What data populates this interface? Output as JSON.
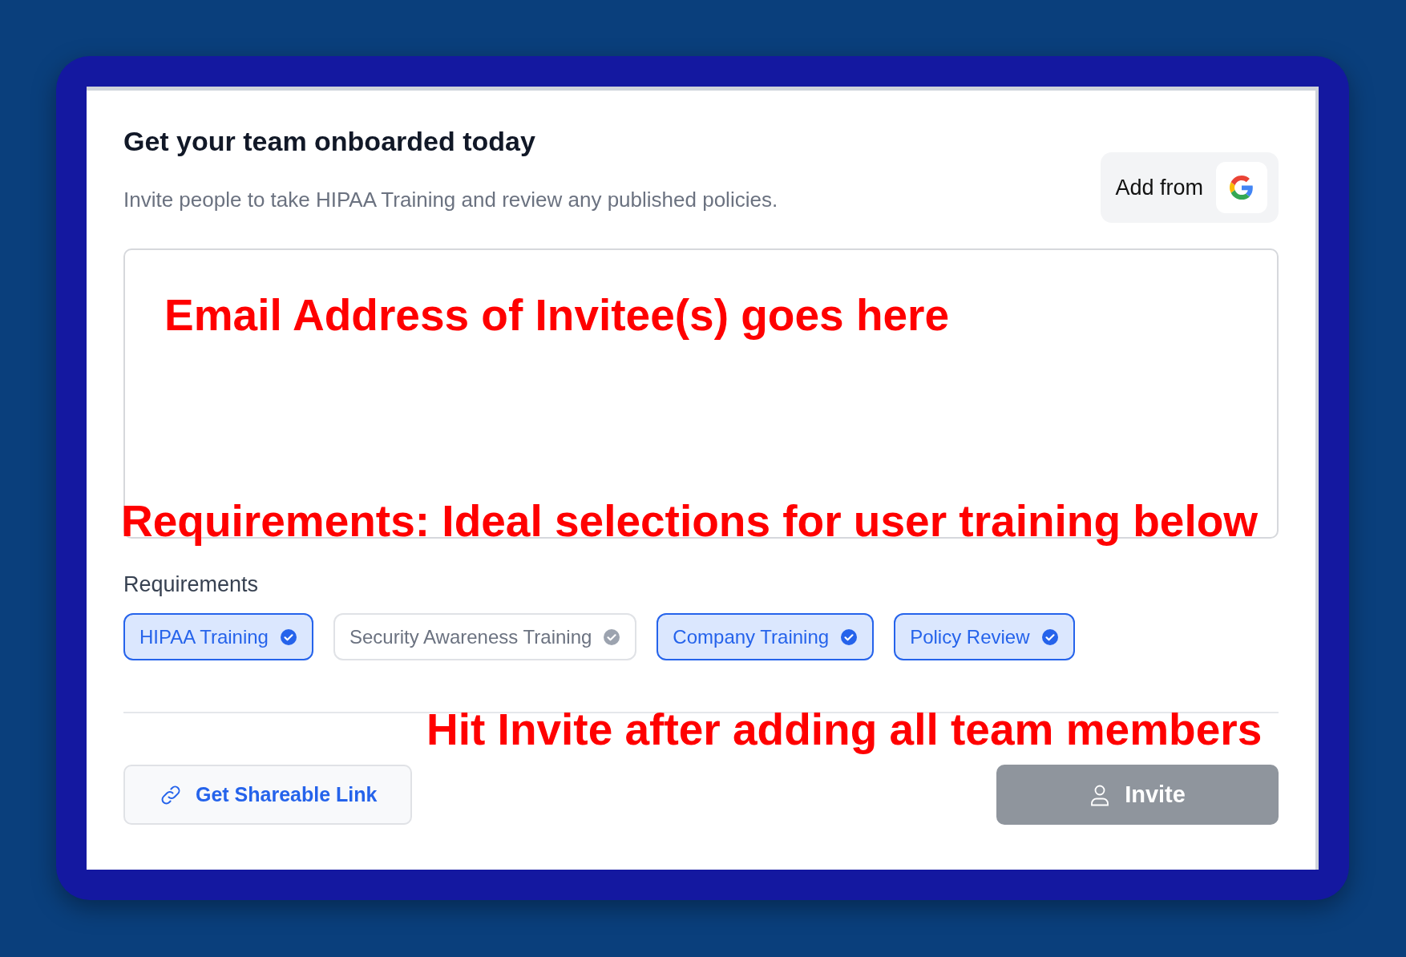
{
  "dialog": {
    "title": "Get your team onboarded today",
    "subtitle": "Invite people to take HIPAA Training and review any published policies.",
    "add_from_button": {
      "label": "Add from"
    }
  },
  "email_field": {
    "kind": "textarea"
  },
  "requirements": {
    "label": "Requirements",
    "items": [
      {
        "label": "HIPAA Training",
        "selected": true
      },
      {
        "label": "Security Awareness Training",
        "selected": false
      },
      {
        "label": "Company Training",
        "selected": true
      },
      {
        "label": "Policy Review",
        "selected": true
      }
    ]
  },
  "shareable_link_button": {
    "label": "Get Shareable Link"
  },
  "invite_button": {
    "label": "Invite",
    "disabled": true
  },
  "annotations": [
    {
      "kind": "email",
      "text": "Email Address of Invitee(s) goes here"
    },
    {
      "kind": "requirements",
      "text": "Requirements: Ideal selections for user training below"
    },
    {
      "kind": "invite",
      "text": "Hit Invite after adding all team members"
    }
  ]
}
